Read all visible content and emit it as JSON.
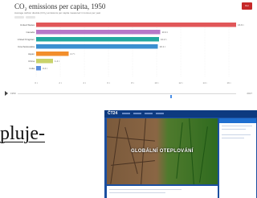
{
  "chart": {
    "title": "CO₂ emissions per capita, 1950",
    "subtitle": "Average carbon dioxide (CO₂) emissions per capita measured in tonnes per year.",
    "logo": "Our World in Data",
    "play_year": "1950",
    "end_year": "2017"
  },
  "chart_data": {
    "type": "bar",
    "orientation": "horizontal",
    "categories": [
      "United States",
      "Canada",
      "United Kingdom",
      "Czechoslovakia",
      "Japan",
      "China",
      "India"
    ],
    "values": [
      16.6,
      10.3,
      10.2,
      10.1,
      2.7,
      1.4,
      0.4
    ],
    "value_labels": [
      "16.6 t",
      "10.3 t",
      "10.2 t",
      "10.1 t",
      "2.7 t",
      "1.4 t",
      "0.4 t"
    ],
    "colors": [
      "#e15759",
      "#b779c8",
      "#22a8a0",
      "#3a8fd0",
      "#f28e2b",
      "#c9d36a",
      "#5a8ede"
    ],
    "xlim": [
      0,
      17
    ],
    "xticks": [
      "0 t",
      "2 t",
      "4 t",
      "6 t",
      "8 t",
      "10 t",
      "12 t",
      "14 t",
      "16 t"
    ],
    "grid": true
  },
  "partial_word": "pluje-",
  "video": {
    "logo": "ČT24",
    "title": "GLOBÁLNÍ OTEPLOVÁNÍ"
  }
}
